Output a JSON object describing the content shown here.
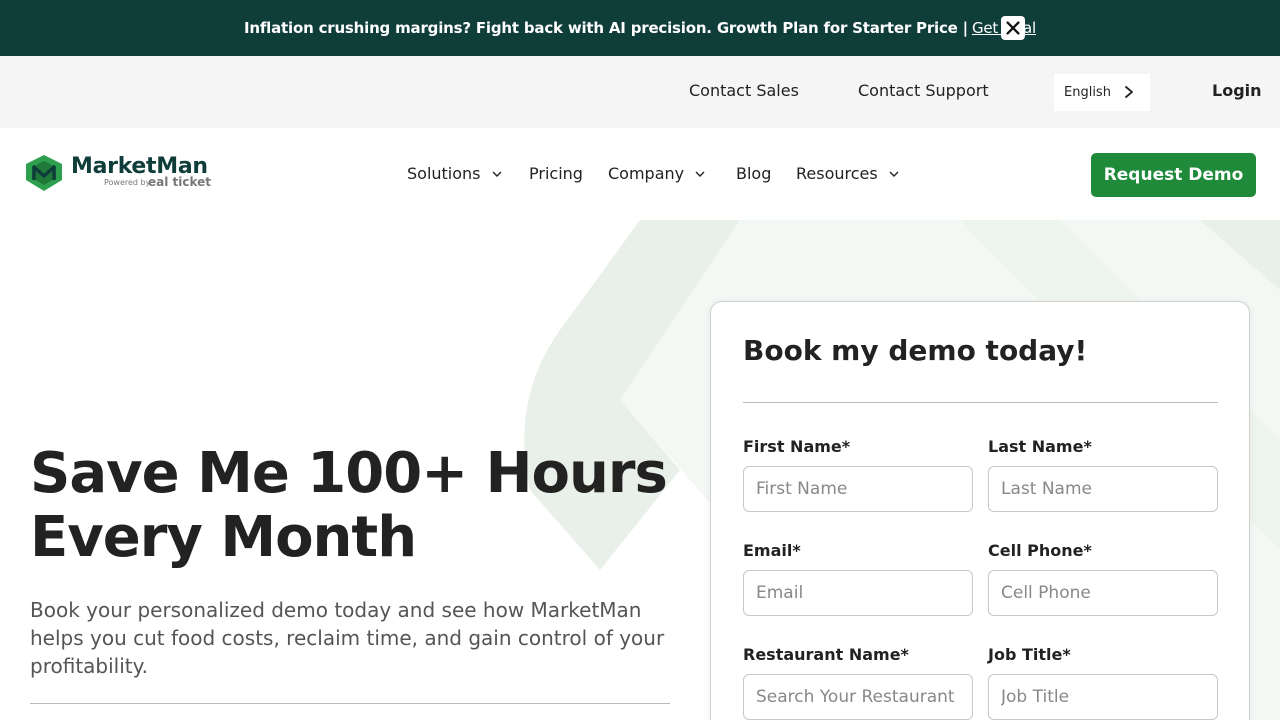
{
  "announcement": {
    "text": "Inflation crushing margins? Fight back with AI precision. Growth Plan for Starter Price | ",
    "link": "Get Deal"
  },
  "utility": {
    "contact_sales": "Contact Sales",
    "contact_support": "Contact Support",
    "language": "English",
    "login": "Login"
  },
  "logo": {
    "brand": "MarketMan",
    "powered": "Powered by",
    "partner": "eal ticket"
  },
  "nav": {
    "solutions": "Solutions",
    "pricing": "Pricing",
    "company": "Company",
    "blog": "Blog",
    "resources": "Resources",
    "cta": "Request Demo"
  },
  "hero": {
    "title": "Save Me 100+ Hours Every Month",
    "subtitle": "Book your personalized demo today and see how MarketMan helps you cut food costs, reclaim time, and gain control of your profitability."
  },
  "form": {
    "title": "Book my demo today!",
    "first_name": {
      "label": "First Name*",
      "placeholder": "First Name"
    },
    "last_name": {
      "label": "Last Name*",
      "placeholder": "Last Name"
    },
    "email": {
      "label": "Email*",
      "placeholder": "Email"
    },
    "phone": {
      "label": "Cell Phone*",
      "placeholder": "Cell Phone"
    },
    "restaurant": {
      "label": "Restaurant Name*",
      "placeholder": "Search Your Restaurant Name"
    },
    "job_title": {
      "label": "Job Title*",
      "placeholder": "Job Title"
    }
  },
  "colors": {
    "announcement_bg": "#0f3d3a",
    "cta": "#1e8a3a",
    "brand_dark": "#0f3d3a"
  },
  "icons": {
    "close": "close-icon",
    "chevron_right": "chevron-right-icon",
    "chevron_down": "chevron-down-icon",
    "logo": "marketman-logo-icon"
  }
}
